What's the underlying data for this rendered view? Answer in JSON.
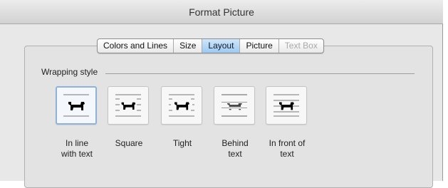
{
  "window": {
    "title": "Format Picture"
  },
  "tabs": [
    {
      "label": "Colors and Lines",
      "state": "normal"
    },
    {
      "label": "Size",
      "state": "normal"
    },
    {
      "label": "Layout",
      "state": "active"
    },
    {
      "label": "Picture",
      "state": "normal"
    },
    {
      "label": "Text Box",
      "state": "disabled"
    }
  ],
  "wrapping": {
    "title": "Wrapping style",
    "options": [
      {
        "label_line1": "In line",
        "label_line2": "with text",
        "icon": "inline-wrap-icon",
        "selected": true
      },
      {
        "label_line1": "Square",
        "label_line2": "",
        "icon": "square-wrap-icon",
        "selected": false
      },
      {
        "label_line1": "Tight",
        "label_line2": "",
        "icon": "tight-wrap-icon",
        "selected": false
      },
      {
        "label_line1": "Behind",
        "label_line2": "text",
        "icon": "behind-text-icon",
        "selected": false
      },
      {
        "label_line1": "In front of",
        "label_line2": "text",
        "icon": "in-front-of-text-icon",
        "selected": false
      }
    ]
  },
  "colors": {
    "accent": "#9cc9f1",
    "selected_border": "#8fb2d9"
  }
}
